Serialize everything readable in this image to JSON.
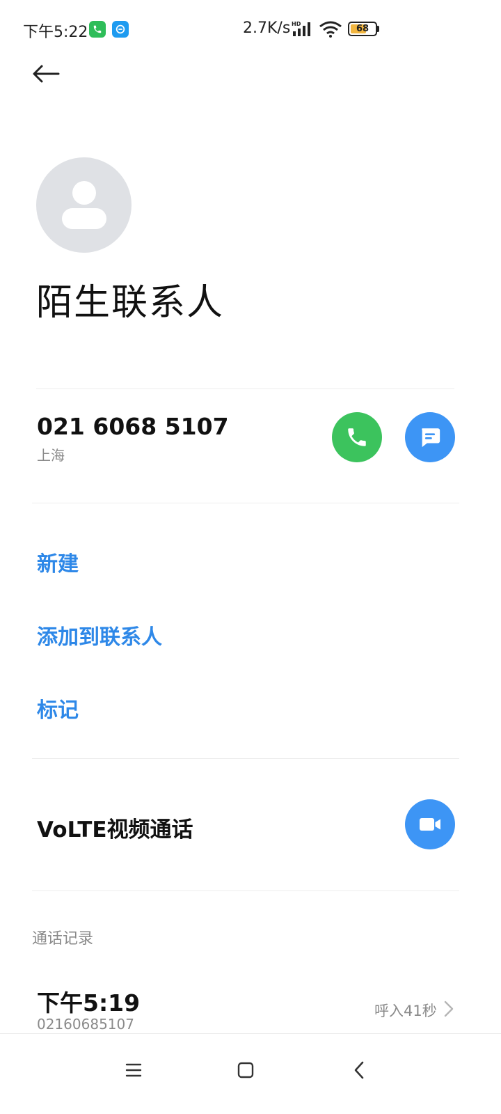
{
  "status_bar": {
    "time": "下午5:22",
    "net_speed": "2.7K/s",
    "battery": "68",
    "battery_level": 0.68
  },
  "contact": {
    "name": "陌生联系人",
    "phone": "021 6068 5107",
    "location": "上海"
  },
  "actions": {
    "new": "新建",
    "add_to_contacts": "添加到联系人",
    "mark": "标记"
  },
  "volte": {
    "label": "VoLTE视频通话"
  },
  "call_log": {
    "title": "通话记录",
    "entries": [
      {
        "time": "下午5:19",
        "number": "02160685107",
        "detail": "呼入41秒"
      }
    ]
  },
  "colors": {
    "accent": "#2e88e8",
    "call_green": "#3cc35d",
    "button_blue": "#3d95f5"
  },
  "icons": [
    "phone-icon",
    "e-app-icon",
    "signal-icon",
    "wifi-icon",
    "battery-icon",
    "back-arrow-icon",
    "avatar-icon",
    "phone-icon",
    "message-icon",
    "video-camera-icon",
    "chevron-right-icon",
    "menu-icon",
    "home-icon",
    "back-icon"
  ]
}
